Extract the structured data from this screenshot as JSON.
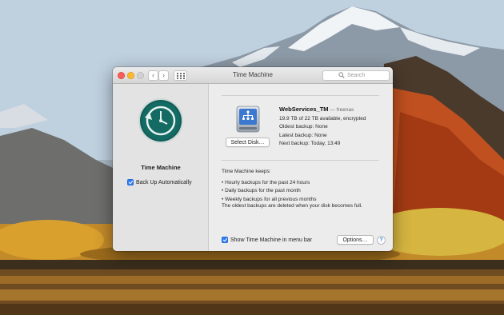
{
  "window": {
    "title": "Time Machine",
    "search_placeholder": "Search"
  },
  "nav": {
    "back_glyph": "‹",
    "forward_glyph": "›"
  },
  "sidebar": {
    "app_name": "Time Machine",
    "backup_auto_label": "Back Up Automatically",
    "backup_auto_checked": true
  },
  "disk": {
    "name": "WebServices_TM",
    "host": "— freenas",
    "capacity": "19.9 TB of 22 TB available, encrypted",
    "oldest": "Oldest backup: None",
    "latest": "Latest backup: None",
    "next": "Next backup: Today, 13:49",
    "select_label": "Select Disk…"
  },
  "info": {
    "heading": "Time Machine keeps:",
    "items": [
      "• Hourly backups for the past 24 hours",
      "• Daily backups for the past month",
      "• Weekly backups for all previous months"
    ],
    "note": "The oldest backups are deleted when your disk becomes full."
  },
  "footer": {
    "menu_bar_label": "Show Time Machine in menu bar",
    "menu_bar_checked": true,
    "options_label": "Options…",
    "help_label": "?"
  },
  "colors": {
    "accent": "#2f7ff5",
    "close": "#fc5f57",
    "minimize": "#fdbc2e",
    "tm_icon": "#136b63"
  }
}
